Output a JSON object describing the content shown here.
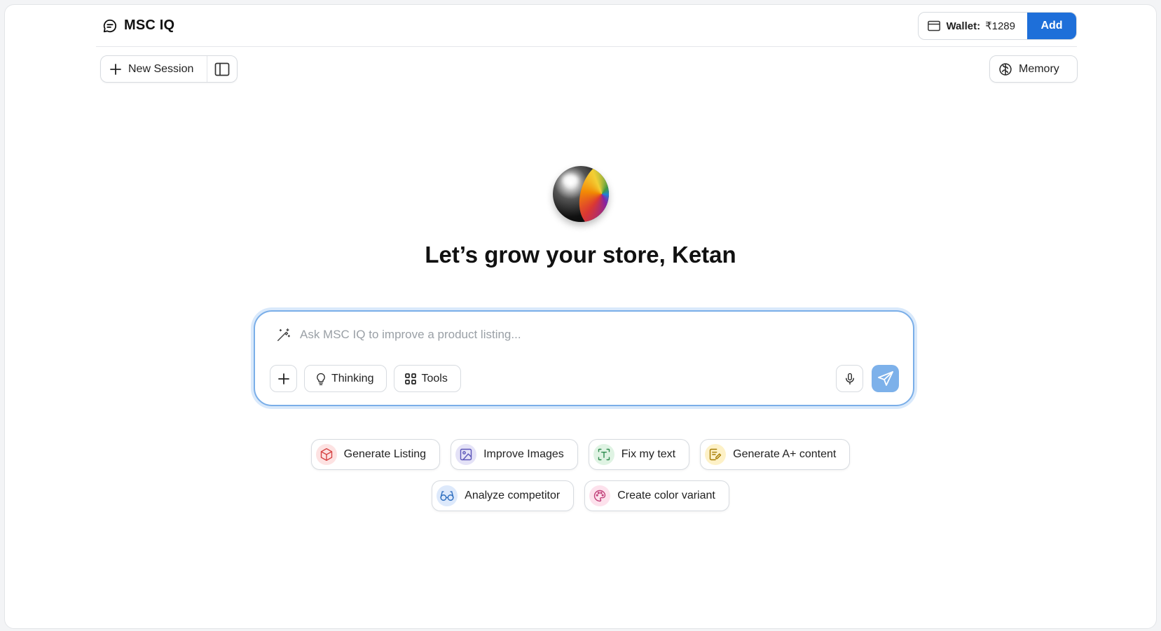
{
  "header": {
    "app_title": "MSC IQ",
    "wallet_label": "Wallet:",
    "wallet_amount": "₹1289",
    "add_label": "Add"
  },
  "toolbar": {
    "new_session_label": "New Session",
    "memory_label": "Memory"
  },
  "hero": {
    "greeting": "Let’s grow your store, Ketan"
  },
  "prompt": {
    "placeholder": "Ask MSC IQ to improve a product listing...",
    "thinking_label": "Thinking",
    "tools_label": "Tools"
  },
  "suggestions": {
    "row1": [
      {
        "label": "Generate Listing",
        "icon": "cube-icon",
        "color": "#fde2e2"
      },
      {
        "label": "Improve Images",
        "icon": "image-icon",
        "color": "#e4e2f7"
      },
      {
        "label": "Fix my text",
        "icon": "text-icon",
        "color": "#dff3e3"
      },
      {
        "label": "Generate A+ content",
        "icon": "document-edit-icon",
        "color": "#fdf1c7"
      }
    ],
    "row2": [
      {
        "label": "Analyze competitor",
        "icon": "glasses-icon",
        "color": "#dde9fb"
      },
      {
        "label": "Create color variant",
        "icon": "palette-icon",
        "color": "#fde1ec"
      }
    ]
  },
  "colors": {
    "accent": "#1e6fd9",
    "send_button": "#7db1ea",
    "prompt_border": "#7aaee8"
  }
}
